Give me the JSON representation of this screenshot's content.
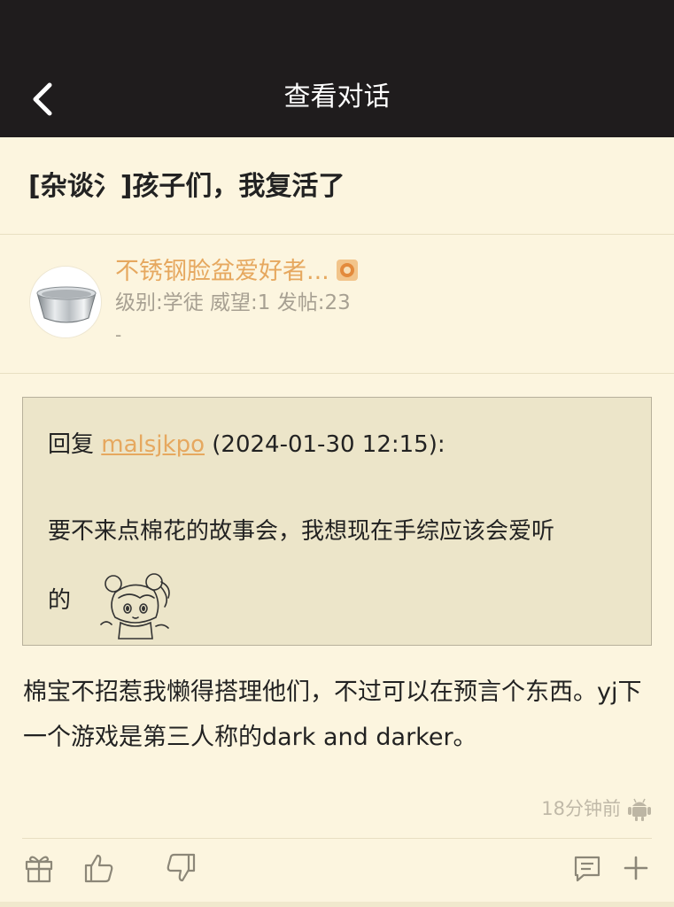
{
  "header": {
    "title": "查看对话"
  },
  "thread": {
    "title": "[杂谈氵]孩子们，我复活了"
  },
  "author": {
    "name": "不锈钢脸盆爱好者...",
    "meta": "级别:学徒 威望:1 发帖:23",
    "signature": "-"
  },
  "quote": {
    "prefix": "回复",
    "user": "malsjkpo",
    "datetime": "(2024-01-30 12:15):",
    "body": "要不来点棉花的故事会，我想现在手综应该会爱听",
    "body_tail": "的"
  },
  "post": {
    "body": "棉宝不招惹我懒得搭理他们，不过可以在预言个东西。yj下一个游戏是第三人称的dark and darker。",
    "time": "18分钟前"
  },
  "icons": {
    "back": "chevron-left-icon",
    "badge": "badge-icon",
    "platform": "android-icon",
    "gift": "gift-icon",
    "upvote": "thumbs-up-icon",
    "downvote": "thumbs-down-icon",
    "comment": "comment-icon",
    "more": "plus-icon"
  },
  "colors": {
    "topbar": "#1f1c1d",
    "background": "#fcf5df",
    "quote_bg": "#ece5c9",
    "accent": "#e6a85f",
    "muted": "#a7a092"
  }
}
